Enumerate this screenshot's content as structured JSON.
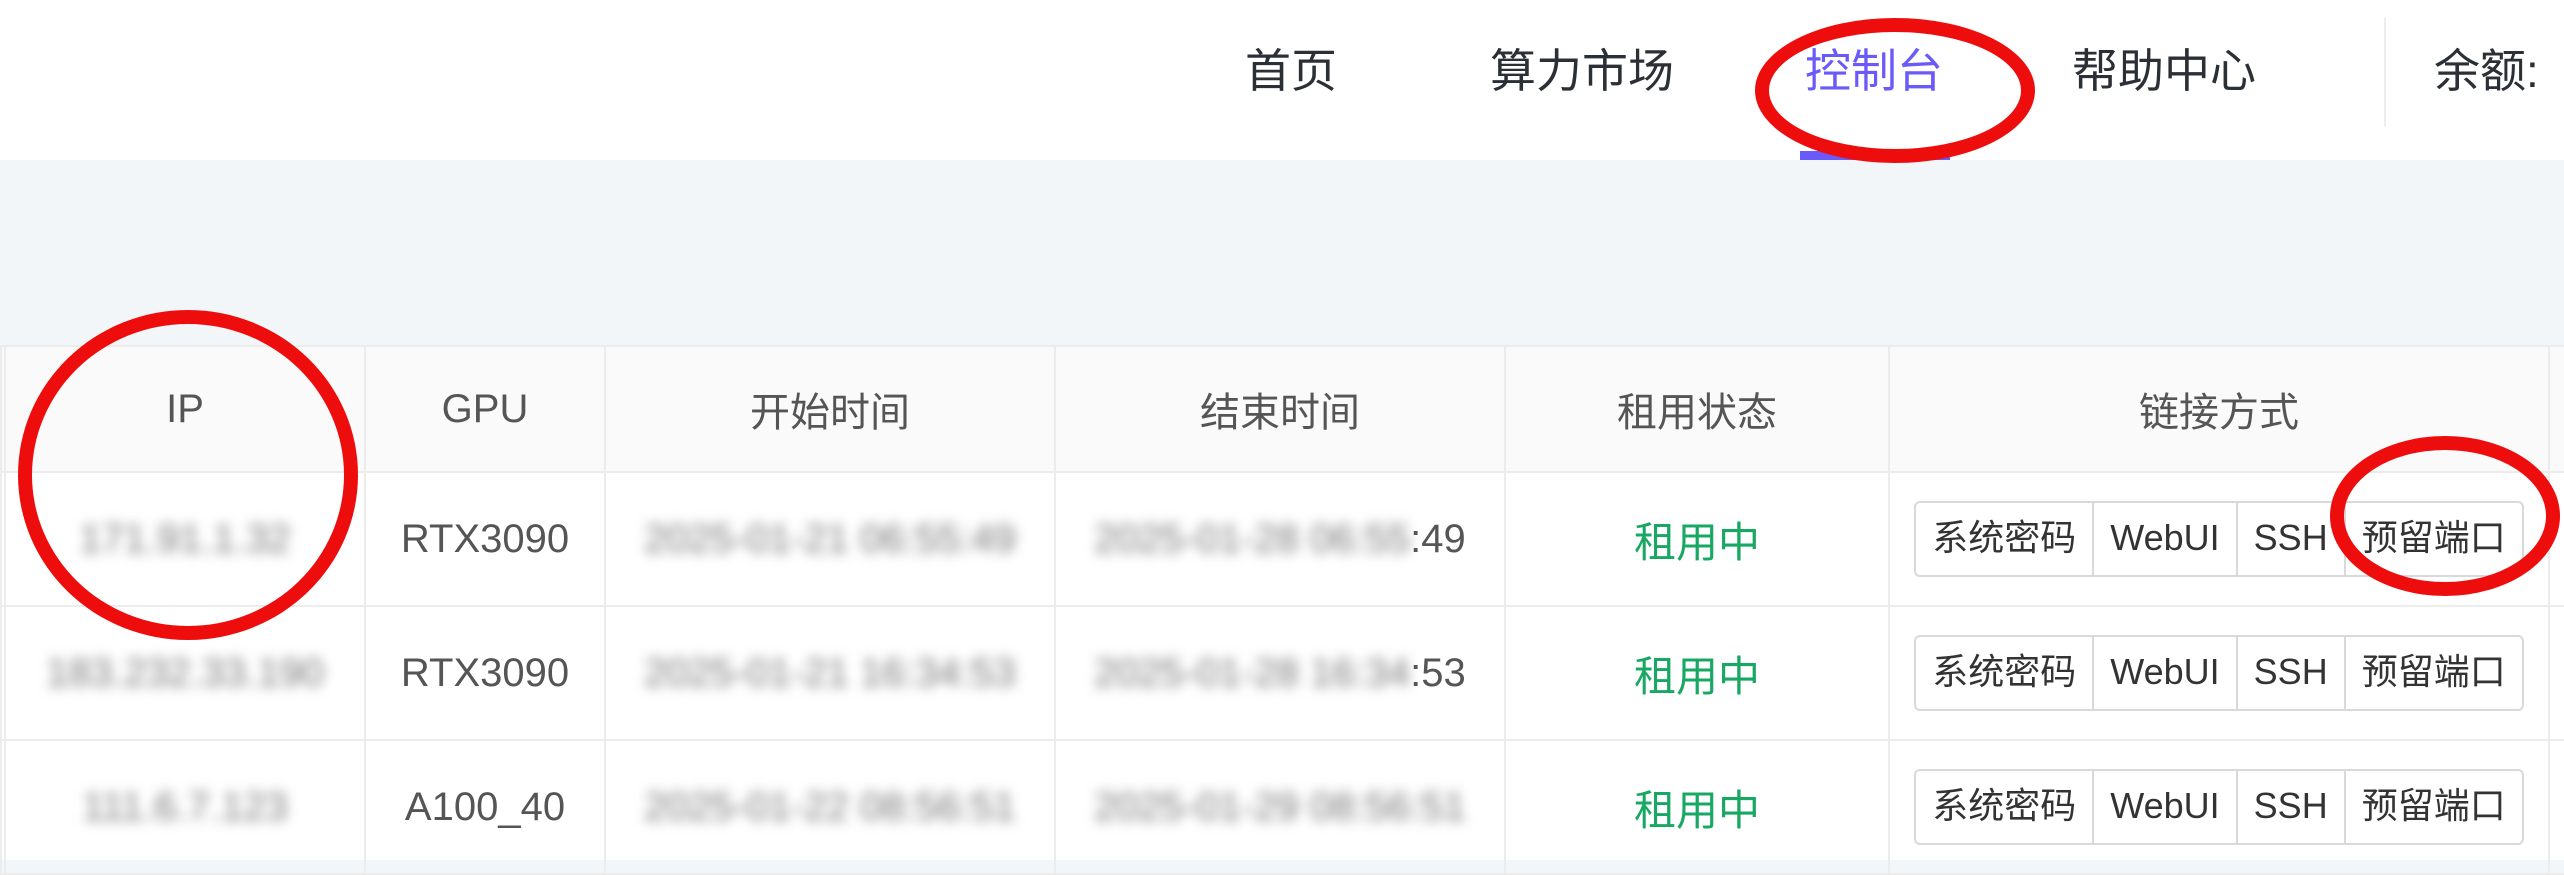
{
  "nav": {
    "items": [
      "首页",
      "算力市场",
      "控制台",
      "帮助中心"
    ],
    "active_index": 2,
    "balance_label": "余额:"
  },
  "table": {
    "headers": [
      "IP",
      "GPU",
      "开始时间",
      "结束时间",
      "租用状态",
      "链接方式"
    ],
    "rows": [
      {
        "ip": "171.91.1.32",
        "gpu": "RTX3090",
        "start": "2025-01-21 06:55:49",
        "end_hidden": "2025-01-28 06:55",
        "end_visible": ":49",
        "status": "租用中"
      },
      {
        "ip": "183.232.33.190",
        "gpu": "RTX3090",
        "start": "2025-01-21 16:34:53",
        "end_hidden": "2025-01-28 16:34",
        "end_visible": ":53",
        "status": "租用中"
      },
      {
        "ip": "111.6.7.123",
        "gpu": "A100_40",
        "start": "2025-01-22 08:56:51",
        "end": "2025-01-29 08:56:51",
        "status": "租用中"
      }
    ],
    "actions": [
      "系统密码",
      "WebUI",
      "SSH",
      "预留端口"
    ]
  },
  "colors": {
    "accent": "#6a5af9",
    "status_active": "#19a864",
    "annotation": "#ee0d0d"
  }
}
